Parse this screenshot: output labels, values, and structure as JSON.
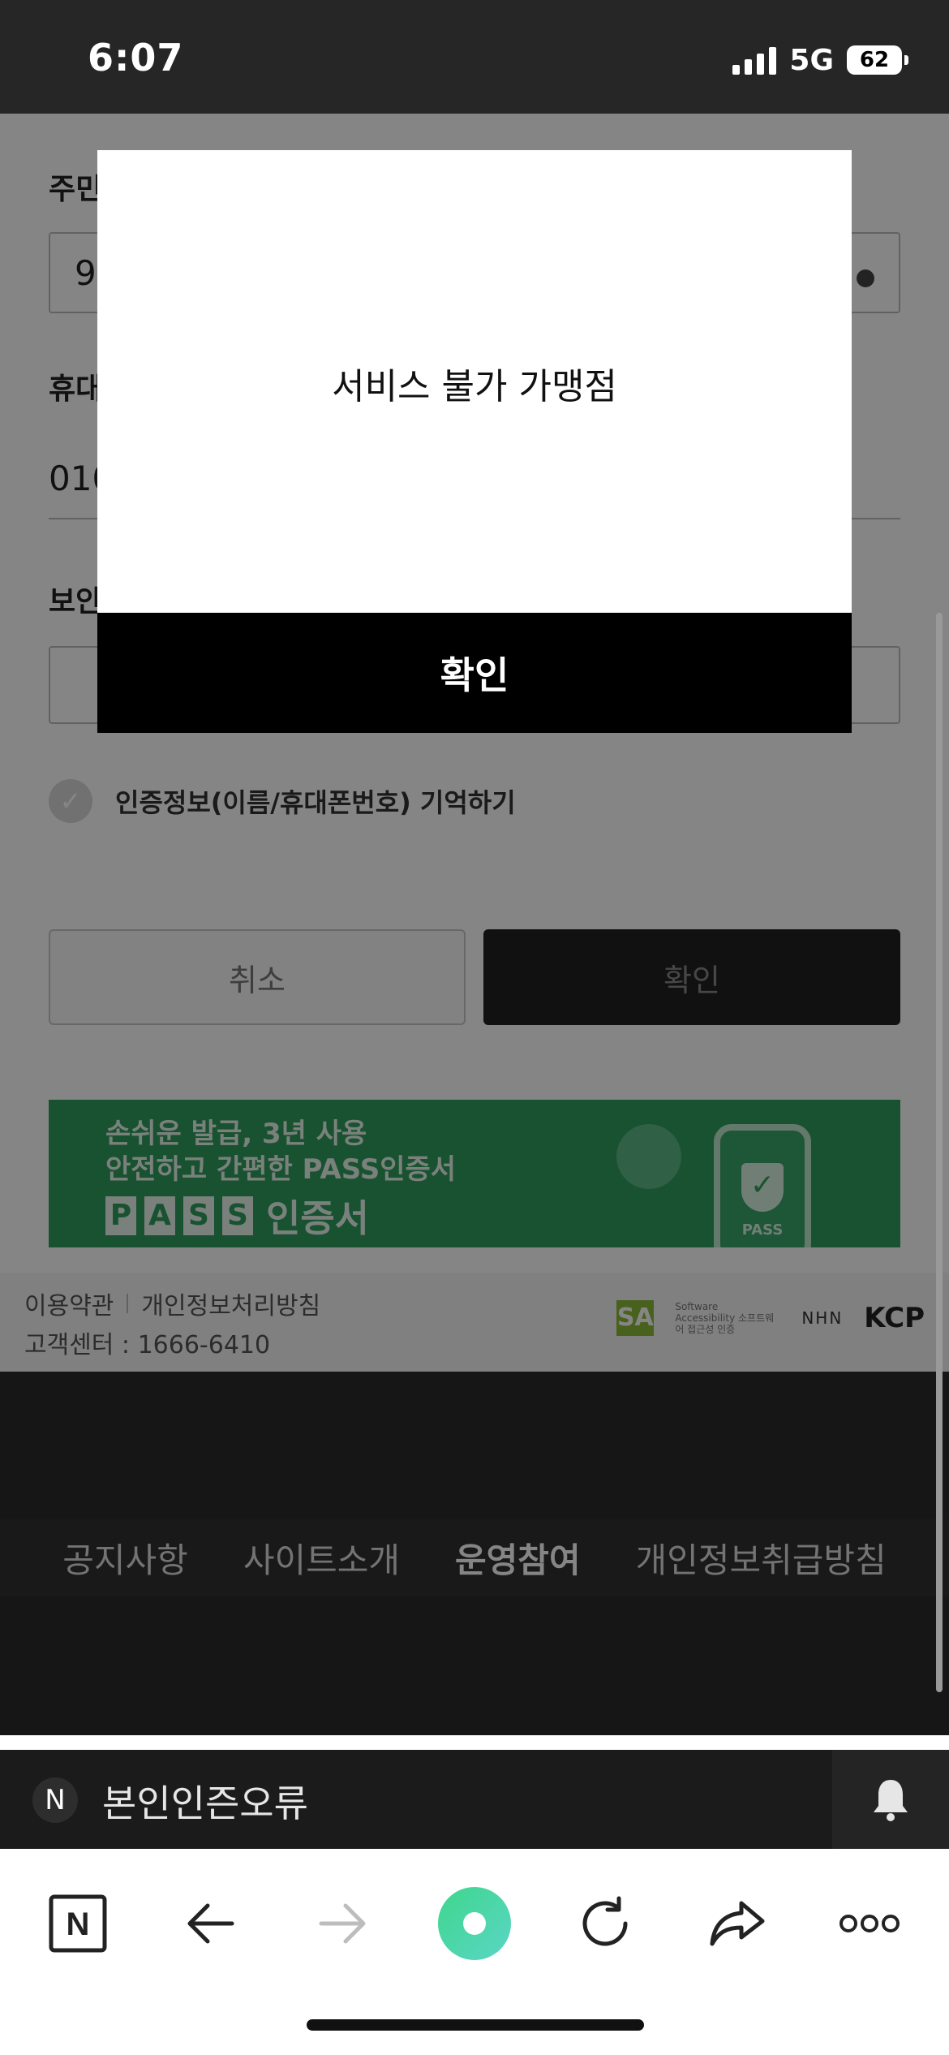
{
  "status_bar": {
    "time": "6:07",
    "network": "5G",
    "battery": "62"
  },
  "form": {
    "rrn_label": "주민",
    "rrn_value": "9",
    "phone_label": "휴대",
    "phone_value": "010",
    "security_label": "보안",
    "remember_label": "인증정보(이름/휴대폰번호) 기억하기",
    "cancel_button": "취소",
    "confirm_button": "확인"
  },
  "banner": {
    "line1": "손쉬운 발급, 3년 사용",
    "line2": "안전하고 간편한 PASS인증서",
    "pass_letters": [
      "P",
      "A",
      "S",
      "S"
    ],
    "cert_label": "인증서",
    "phone_label": "PASS"
  },
  "footer": {
    "terms": "이용약관",
    "privacy": "개인정보처리방침",
    "customer_center": "고객센터 : 1666-6410",
    "sa_logo": "SA",
    "sa_caption": "Software Accessibility 소프트웨어 접근성 인증",
    "kcp_prefix": "NHN",
    "kcp": "KCP"
  },
  "site_nav": {
    "items": [
      {
        "label": "공지사항",
        "active": false
      },
      {
        "label": "사이트소개",
        "active": false
      },
      {
        "label": "운영참여",
        "active": true
      },
      {
        "label": "개인정보취급방침",
        "active": false
      }
    ]
  },
  "modal": {
    "message": "서비스 불가 가맹점",
    "button": "확인"
  },
  "search_bar": {
    "badge": "N",
    "query": "본인인즌오류"
  },
  "toolbar": {
    "home_badge": "N"
  },
  "colors": {
    "banner_green": "#2f9e5f",
    "modal_button": "#000000",
    "overlay": "rgba(0,0,0,0.48)"
  }
}
